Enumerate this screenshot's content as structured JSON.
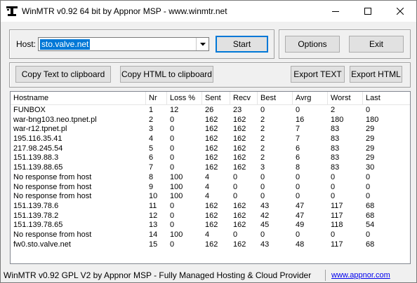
{
  "window": {
    "title": "WinMTR v0.92 64 bit by Appnor MSP - www.winmtr.net",
    "minimize_icon": "minimize-icon",
    "maximize_icon": "maximize-icon",
    "close_icon": "close-icon"
  },
  "host": {
    "label": "Host:",
    "value": "sto.valve.net"
  },
  "buttons": {
    "start": "Start",
    "options": "Options",
    "exit": "Exit",
    "copy_text": "Copy Text to clipboard",
    "copy_html": "Copy HTML to clipboard",
    "export_text": "Export TEXT",
    "export_html": "Export HTML"
  },
  "table": {
    "columns": [
      "Hostname",
      "Nr",
      "Loss %",
      "Sent",
      "Recv",
      "Best",
      "Avrg",
      "Worst",
      "Last"
    ],
    "rows": [
      [
        "FUNBOX",
        "1",
        "12",
        "26",
        "23",
        "0",
        "0",
        "2",
        "0"
      ],
      [
        "war-bng103.neo.tpnet.pl",
        "2",
        "0",
        "162",
        "162",
        "2",
        "16",
        "180",
        "180"
      ],
      [
        "war-r12.tpnet.pl",
        "3",
        "0",
        "162",
        "162",
        "2",
        "7",
        "83",
        "29"
      ],
      [
        "195.116.35.41",
        "4",
        "0",
        "162",
        "162",
        "2",
        "7",
        "83",
        "29"
      ],
      [
        "217.98.245.54",
        "5",
        "0",
        "162",
        "162",
        "2",
        "6",
        "83",
        "29"
      ],
      [
        "151.139.88.3",
        "6",
        "0",
        "162",
        "162",
        "2",
        "6",
        "83",
        "29"
      ],
      [
        "151.139.88.65",
        "7",
        "0",
        "162",
        "162",
        "3",
        "8",
        "83",
        "30"
      ],
      [
        "No response from host",
        "8",
        "100",
        "4",
        "0",
        "0",
        "0",
        "0",
        "0"
      ],
      [
        "No response from host",
        "9",
        "100",
        "4",
        "0",
        "0",
        "0",
        "0",
        "0"
      ],
      [
        "No response from host",
        "10",
        "100",
        "4",
        "0",
        "0",
        "0",
        "0",
        "0"
      ],
      [
        "151.139.78.6",
        "11",
        "0",
        "162",
        "162",
        "43",
        "47",
        "117",
        "68"
      ],
      [
        "151.139.78.2",
        "12",
        "0",
        "162",
        "162",
        "42",
        "47",
        "117",
        "68"
      ],
      [
        "151.139.78.65",
        "13",
        "0",
        "162",
        "162",
        "45",
        "49",
        "118",
        "54"
      ],
      [
        "No response from host",
        "14",
        "100",
        "4",
        "0",
        "0",
        "0",
        "0",
        "0"
      ],
      [
        "fw0.sto.valve.net",
        "15",
        "0",
        "162",
        "162",
        "43",
        "48",
        "117",
        "68"
      ]
    ]
  },
  "status": {
    "text": "WinMTR v0.92 GPL V2 by Appnor MSP - Fully Managed Hosting & Cloud Provider",
    "link": "www.appnor.com"
  }
}
